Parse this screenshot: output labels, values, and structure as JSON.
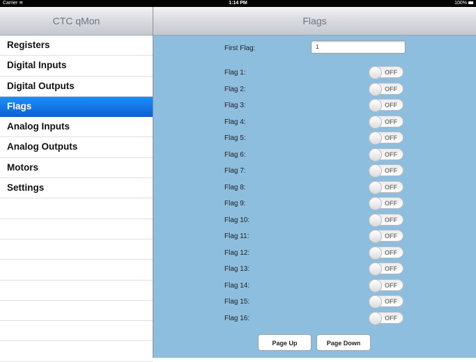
{
  "status_bar": {
    "carrier": "Carrier",
    "time": "1:14 PM",
    "battery": "100%"
  },
  "master": {
    "title": "CTC qMon",
    "items": [
      {
        "label": "Registers"
      },
      {
        "label": "Digital Inputs"
      },
      {
        "label": "Digital Outputs"
      },
      {
        "label": "Flags",
        "selected": true
      },
      {
        "label": "Analog Inputs"
      },
      {
        "label": "Analog Outputs"
      },
      {
        "label": "Motors"
      },
      {
        "label": "Settings"
      }
    ]
  },
  "detail": {
    "title": "Flags",
    "first_flag_label": "First Flag:",
    "first_flag_value": "1",
    "flags": [
      {
        "label": "Flag 1:",
        "state": "OFF"
      },
      {
        "label": "Flag 2:",
        "state": "OFF"
      },
      {
        "label": "Flag 3:",
        "state": "OFF"
      },
      {
        "label": "Flag 4:",
        "state": "OFF"
      },
      {
        "label": "Flag 5:",
        "state": "OFF"
      },
      {
        "label": "Flag 6:",
        "state": "OFF"
      },
      {
        "label": "Flag 7:",
        "state": "OFF"
      },
      {
        "label": "Flag 8:",
        "state": "OFF"
      },
      {
        "label": "Flag 9:",
        "state": "OFF"
      },
      {
        "label": "Flag 10:",
        "state": "OFF"
      },
      {
        "label": "Flag 11:",
        "state": "OFF"
      },
      {
        "label": "Flag 12:",
        "state": "OFF"
      },
      {
        "label": "Flag 13:",
        "state": "OFF"
      },
      {
        "label": "Flag 14:",
        "state": "OFF"
      },
      {
        "label": "Flag 15:",
        "state": "OFF"
      },
      {
        "label": "Flag 16:",
        "state": "OFF"
      }
    ],
    "page_up_label": "Page Up",
    "page_down_label": "Page Down"
  },
  "colors": {
    "detail_background": "#8dbede",
    "selected_row": "#1478e8"
  }
}
